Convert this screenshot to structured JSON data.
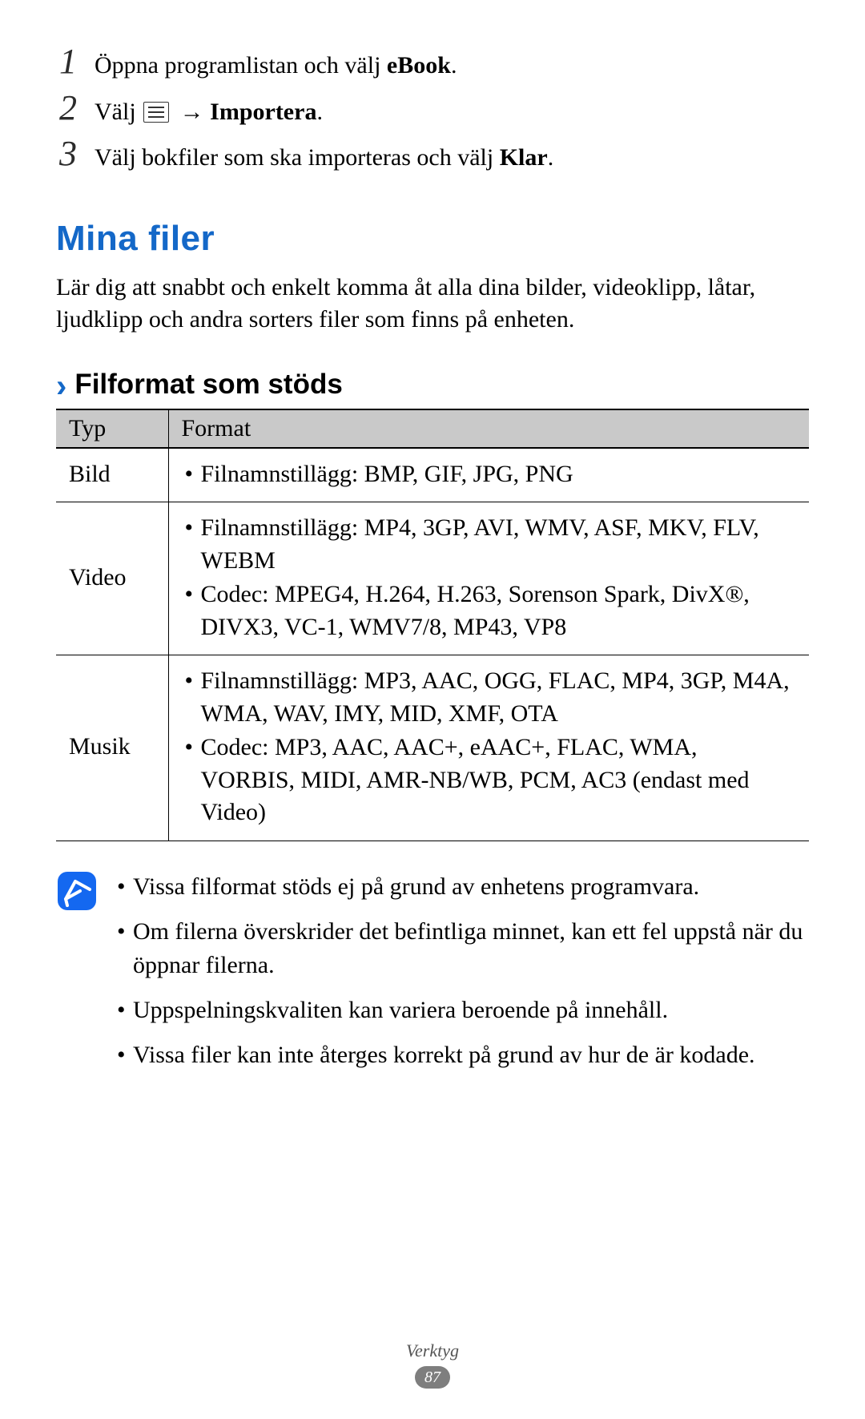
{
  "steps": {
    "s1": {
      "num": "1",
      "pre": "Öppna programlistan och välj ",
      "bold": "eBook",
      "post": "."
    },
    "s2": {
      "num": "2",
      "pre": "Välj ",
      "arrow": "→",
      "bold": " Importera",
      "post": "."
    },
    "s3": {
      "num": "3",
      "pre": "Välj bokfiler som ska importeras och välj ",
      "bold": "Klar",
      "post": "."
    }
  },
  "heading": "Mina filer",
  "intro": "Lär dig att snabbt och enkelt komma åt alla dina bilder, videoklipp, låtar, ljudklipp och andra sorters filer som finns på enheten.",
  "subheading": "Filformat som stöds",
  "table": {
    "headers": {
      "type": "Typ",
      "format": "Format"
    },
    "rows": [
      {
        "type": "Bild",
        "items": [
          "Filnamnstillägg: BMP, GIF, JPG, PNG"
        ]
      },
      {
        "type": "Video",
        "items": [
          "Filnamnstillägg: MP4, 3GP, AVI, WMV, ASF, MKV, FLV, WEBM",
          "Codec: MPEG4, H.264, H.263, Sorenson Spark, DivX®, DIVX3, VC-1, WMV7/8, MP43, VP8"
        ]
      },
      {
        "type": "Musik",
        "items": [
          "Filnamnstillägg: MP3, AAC, OGG, FLAC, MP4, 3GP, M4A, WMA, WAV, IMY, MID, XMF, OTA",
          "Codec: MP3, AAC, AAC+, eAAC+, FLAC, WMA, VORBIS, MIDI, AMR-NB/WB, PCM, AC3 (endast med Video)"
        ]
      }
    ]
  },
  "notes": [
    "Vissa filformat stöds ej på grund av enhetens programvara.",
    "Om filerna överskrider det befintliga minnet, kan ett fel uppstå när du öppnar filerna.",
    "Uppspelningskvaliten kan variera beroende på innehåll.",
    "Vissa filer kan inte återges korrekt på grund av hur de är kodade."
  ],
  "footer": {
    "section": "Verktyg",
    "page": "87"
  }
}
